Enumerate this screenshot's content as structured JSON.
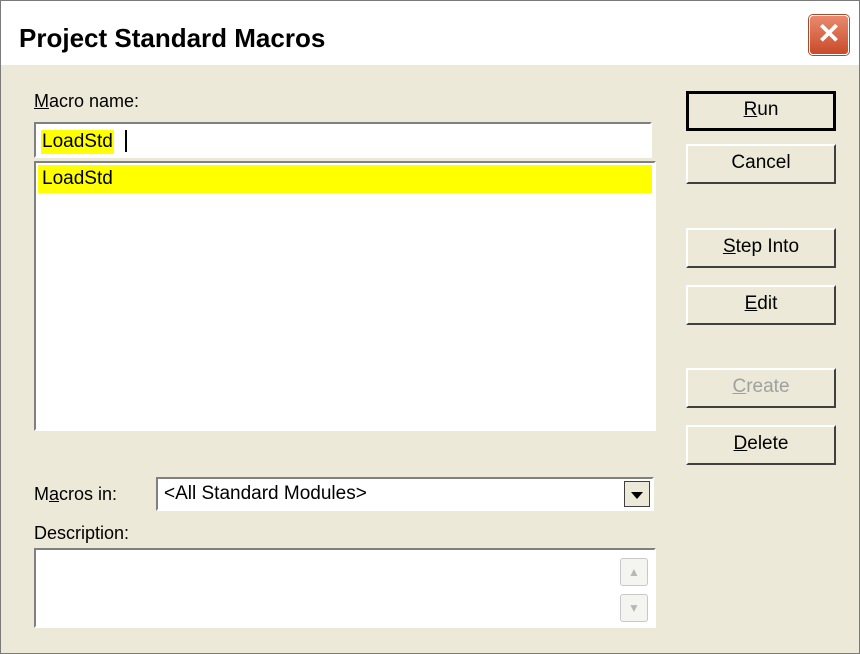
{
  "window": {
    "title": "Project Standard Macros",
    "close_glyph": "✕"
  },
  "macro_name": {
    "label_prefix": "",
    "label_mnemonic": "M",
    "label_rest": "acro name:",
    "value": "LoadStd"
  },
  "macro_list": {
    "items": [
      "LoadStd"
    ],
    "selected_index": 0
  },
  "buttons": {
    "run": {
      "mnemonic": "R",
      "rest": "un"
    },
    "cancel": {
      "label": "Cancel"
    },
    "step_into": {
      "mnemonic": "S",
      "rest": "tep Into"
    },
    "edit": {
      "mnemonic": "E",
      "rest": "dit"
    },
    "create": {
      "mnemonic": "C",
      "rest": "reate",
      "enabled": false
    },
    "delete": {
      "mnemonic": "D",
      "rest": "elete"
    }
  },
  "macros_in": {
    "label_prefix": "M",
    "label_mnemonic": "a",
    "label_rest": "cros in:",
    "selected": "<All Standard Modules>"
  },
  "description": {
    "label": "Description:",
    "value": ""
  },
  "colors": {
    "dialog_bg": "#ece9d8",
    "highlight": "#ffff00",
    "close_button": "#c94a2a"
  }
}
